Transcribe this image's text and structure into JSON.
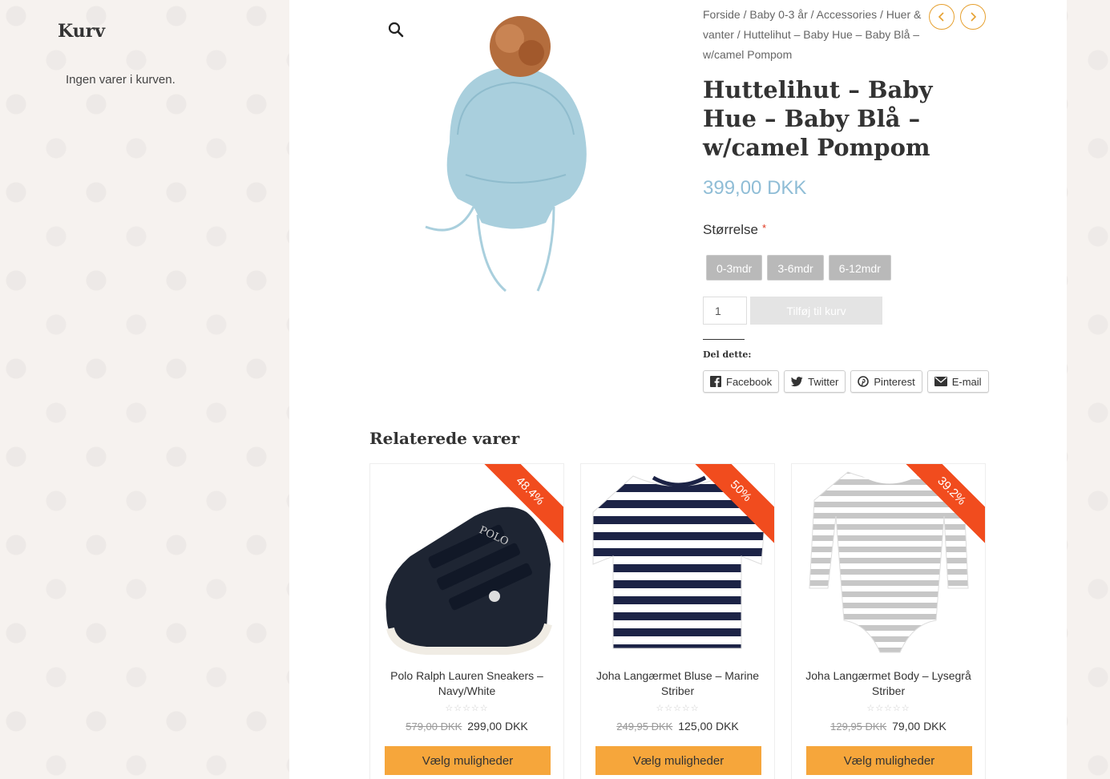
{
  "sidebar": {
    "title": "Kurv",
    "empty_text": "Ingen varer i kurven."
  },
  "breadcrumb": {
    "items": [
      "Forside",
      "Baby 0-3 år",
      "Accessories",
      "Huer & vanter"
    ],
    "current": "Huttelihut – Baby Hue – Baby Blå – w/camel Pompom",
    "separator": " / "
  },
  "product": {
    "title": "Huttelihut – Baby Hue – Baby Blå – w/camel Pompom",
    "price": "399,00 DKK",
    "size_label": "Størrelse",
    "required_mark": "*",
    "sizes": [
      "0-3mdr",
      "3-6mdr",
      "6-12mdr"
    ],
    "quantity": "1",
    "add_to_cart": "Tilføj til kurv"
  },
  "share": {
    "label": "Del dette:",
    "buttons": [
      "Facebook",
      "Twitter",
      "Pinterest",
      "E-mail"
    ]
  },
  "related": {
    "title": "Relaterede varer",
    "items": [
      {
        "name": "Polo Ralph Lauren Sneakers – Navy/White",
        "badge": "48.4%",
        "old_price": "579,00 DKK",
        "price": "299,00 DKK",
        "button": "Vælg muligheder"
      },
      {
        "name": "Joha Langærmet Bluse – Marine Striber",
        "badge": "50%",
        "old_price": "249,95 DKK",
        "price": "125,00 DKK",
        "button": "Vælg muligheder"
      },
      {
        "name": "Joha Langærmet Body – Lysegrå Striber",
        "badge": "39.2%",
        "old_price": "129,95 DKK",
        "price": "79,00 DKK",
        "button": "Vælg muligheder"
      }
    ]
  },
  "colors": {
    "accent": "#f6a63b",
    "price": "#8fbdd6",
    "badge": "#f14c1e"
  }
}
